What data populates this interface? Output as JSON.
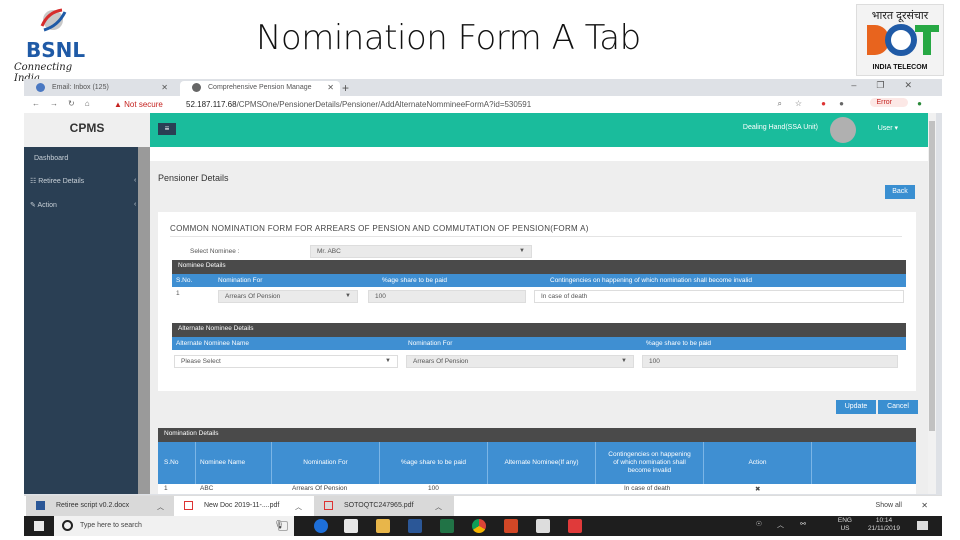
{
  "slide": {
    "title": "Nomination Form A Tab",
    "left_logo": {
      "name": "BSNL",
      "tagline": "Connecting India"
    },
    "right_logo": {
      "hindi": "भारत दूरसंचार",
      "text": "DOT",
      "label": "INDIA TELECOM"
    }
  },
  "browser": {
    "tabs": [
      {
        "label": "Email: Inbox (125)",
        "active": false
      },
      {
        "label": "Comprehensive Pension Manage",
        "active": true
      }
    ],
    "new_tab": "+",
    "window_controls": [
      "–",
      "❐",
      "✕"
    ],
    "nav": [
      "←",
      "→",
      "↻",
      "⌂"
    ],
    "security": "▲ Not secure",
    "url_host": "52.187.117.68",
    "url_path": "/CPMSOne/PensionerDetails/Pensioner/AddAlternateNommineeFormA?id=530591",
    "error_badge": "Error"
  },
  "app": {
    "brand": "CPMS",
    "menu_icon": "≡",
    "role": "Dealing Hand(SSA Unit)",
    "user_menu": "User ▾",
    "sidebar": [
      {
        "icon": "",
        "label": "Dashboard"
      },
      {
        "icon": "☷",
        "label": "Retiree Details",
        "chevron": "‹"
      },
      {
        "icon": "✎",
        "label": "Action",
        "chevron": "‹"
      }
    ],
    "page_title": "Pensioner Details",
    "back_button": "Back",
    "form": {
      "title": "COMMON NOMINATION FORM FOR ARREARS OF PENSION AND COMMUTATION OF PENSION(FORM A)",
      "select_nominee_label": "Select Nominee :",
      "select_nominee_value": "Mr. ABC",
      "nominee_details": {
        "title": "Nominee Details",
        "headers": [
          "S.No.",
          "Nomination For",
          "%age share to be paid",
          "Contingencies on happening of which nomination shall become invalid"
        ],
        "row": {
          "sno": "1",
          "nomination_for": "Arrears Of Pension",
          "share": "100",
          "contingency": "In case of death"
        }
      },
      "alternate_nominee_details": {
        "title": "Alternate Nominee Details",
        "headers": [
          "Alternate Nominee Name",
          "Nomination For",
          "%age share to be paid"
        ],
        "row": {
          "name": "Please Select",
          "nomination_for": "Arrears Of Pension",
          "share": "100"
        }
      },
      "update_button": "Update",
      "cancel_button": "Cancel"
    },
    "nomination_details": {
      "title": "Nomination Details",
      "headers": [
        "S.No",
        "Nominee Name",
        "Nomination For",
        "%age share to be paid",
        "Alternate Nominee(If any)",
        "Contingencies on happening of which nomination shall become invalid",
        "Action",
        ""
      ],
      "rows": [
        {
          "sno": "1",
          "name": "ABC",
          "nomination_for": "Arrears Of Pension",
          "share": "100",
          "alternate": "",
          "contingency": "In case of death",
          "action": "✖"
        }
      ]
    }
  },
  "downloads": {
    "items": [
      {
        "name": "Retiree script v0.2.docx",
        "type": "docx"
      },
      {
        "name": "New Doc 2019-11-....pdf",
        "type": "pdf"
      },
      {
        "name": "SOTOQTC247965.pdf",
        "type": "pdf"
      }
    ],
    "show_all": "Show all",
    "close": "✕"
  },
  "taskbar": {
    "search_placeholder": "Type here to search",
    "language": [
      "ENG",
      "US"
    ],
    "time": "10:14",
    "date": "21/11/2019"
  }
}
